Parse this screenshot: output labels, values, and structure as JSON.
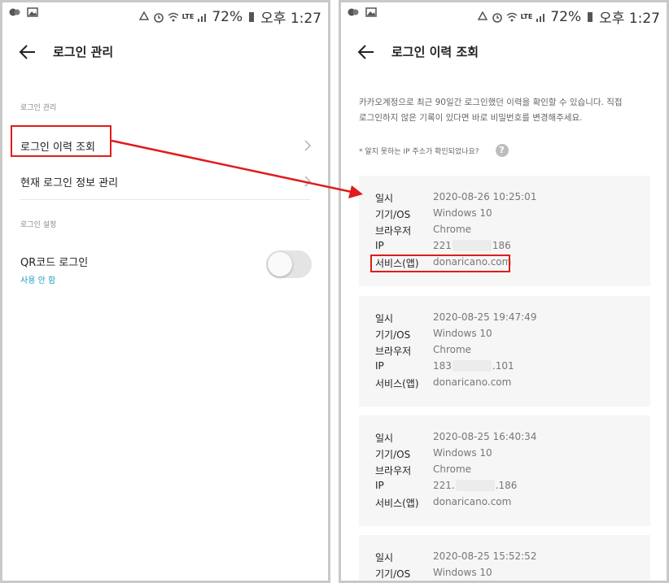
{
  "status_bar": {
    "battery": "72%",
    "time": "오후 1:27",
    "network": "LTE"
  },
  "left_screen": {
    "title": "로그인 관리",
    "section_login_manage": "로그인 관리",
    "menu_history": "로그인 이력 조회",
    "menu_current": "현재 로그인 정보 관리",
    "section_login_settings": "로그인 설정",
    "qr_label": "QR코드 로그인",
    "qr_status": "사용 안 함",
    "qr_enabled": false
  },
  "right_screen": {
    "title": "로그인 이력 조회",
    "description_line1": "카카오계정으로 최근 90일간 로그인했던 이력을 확인할 수 있습니다. 직접",
    "description_line2": "로그인하지 않은 기록이 있다면 바로 비밀번호를 변경해주세요.",
    "ip_note": "* 알지 못하는 IP 주소가 확인되었나요?",
    "help_icon_label": "?",
    "labels": {
      "datetime": "일시",
      "device": "기기/OS",
      "browser": "브라우저",
      "ip": "IP",
      "service": "서비스(앱)"
    },
    "records": [
      {
        "datetime": "2020-08-26 10:25:01",
        "device": "Windows 10",
        "browser": "Chrome",
        "ip_prefix": "221",
        "ip_suffix": "186",
        "service": "donaricano.com"
      },
      {
        "datetime": "2020-08-25 19:47:49",
        "device": "Windows 10",
        "browser": "Chrome",
        "ip_prefix": "183",
        "ip_suffix": ".101",
        "service": "donaricano.com"
      },
      {
        "datetime": "2020-08-25 16:40:34",
        "device": "Windows 10",
        "browser": "Chrome",
        "ip_prefix": "221.",
        "ip_suffix": ".186",
        "service": "donaricano.com"
      },
      {
        "datetime": "2020-08-25 15:52:52",
        "device": "Windows 10",
        "browser": "",
        "ip_prefix": "",
        "ip_suffix": "",
        "service": ""
      }
    ]
  },
  "colors": {
    "annotation": "#e01c1c",
    "accent_link": "#1a9bbf",
    "card_bg": "#f6f6f6"
  }
}
